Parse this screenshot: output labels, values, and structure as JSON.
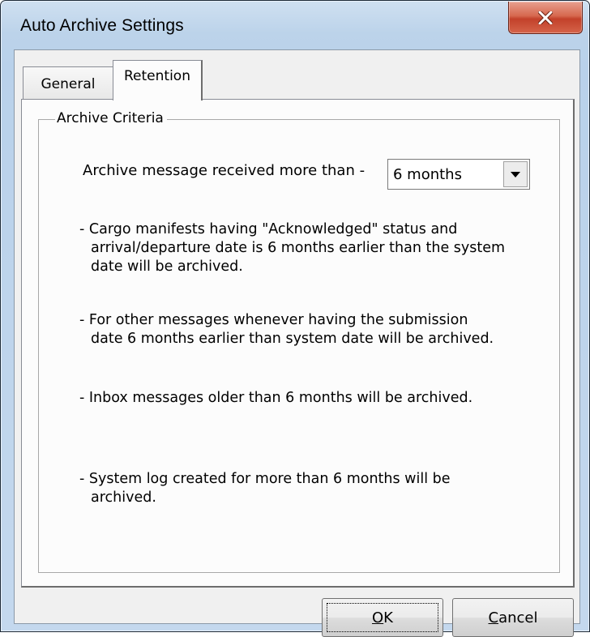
{
  "window": {
    "title": "Auto Archive Settings",
    "close_icon": "close-x-icon"
  },
  "tabs": [
    {
      "label": "General",
      "selected": false
    },
    {
      "label": "Retention",
      "selected": true
    }
  ],
  "archive_criteria": {
    "legend": "Archive Criteria",
    "archive_label": "Archive message received more than -",
    "period_select": {
      "value": "6 months",
      "arrow_icon": "dropdown-arrow-icon"
    },
    "notes": [
      "- Cargo manifests having \"Acknowledged\" status and\narrival/departure date is 6 months earlier than the system\ndate will be archived.",
      "- For other messages whenever having the submission\ndate 6 months earlier than system date will be archived.",
      "- Inbox messages older than 6 months will be archived.",
      "- System log created for more than 6 months will be\narchived."
    ]
  },
  "buttons": {
    "ok": {
      "mnemonic": "O",
      "rest": "K"
    },
    "cancel": {
      "mnemonic": "C",
      "rest": "ancel"
    }
  },
  "colors": {
    "close_button": "#c7432b",
    "frame": "#bcd3ea",
    "dialog_face": "#f0f0f0"
  }
}
